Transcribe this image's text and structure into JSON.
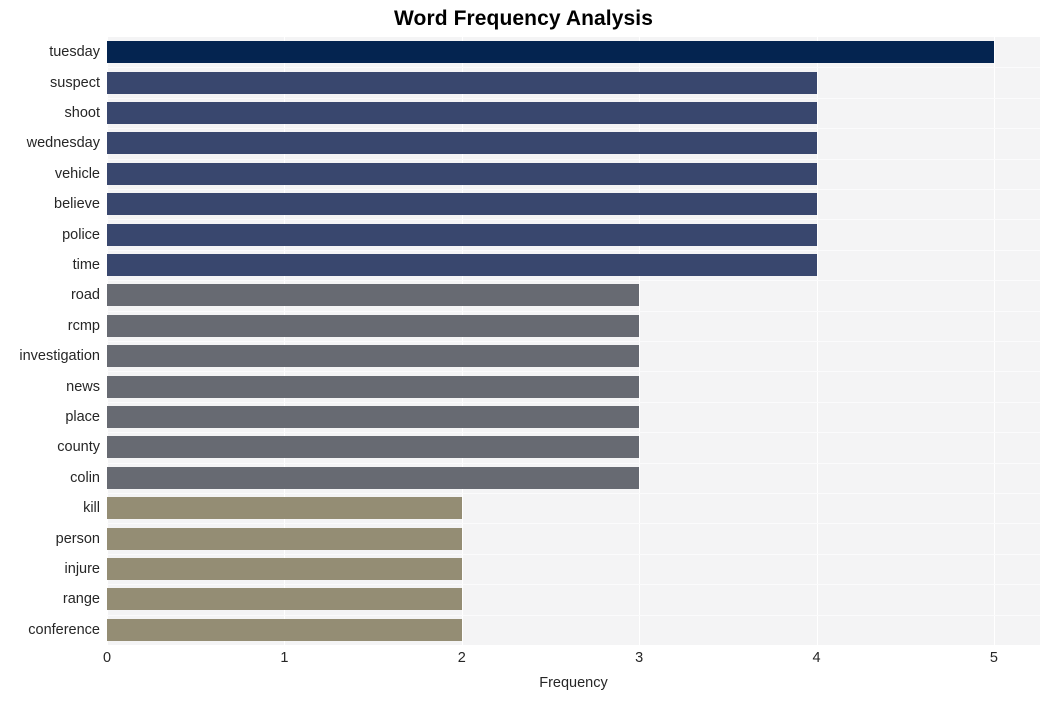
{
  "chart_data": {
    "type": "bar",
    "orientation": "horizontal",
    "title": "Word Frequency Analysis",
    "xlabel": "Frequency",
    "ylabel": "",
    "categories": [
      "tuesday",
      "suspect",
      "shoot",
      "wednesday",
      "vehicle",
      "believe",
      "police",
      "time",
      "road",
      "rcmp",
      "investigation",
      "news",
      "place",
      "county",
      "colin",
      "kill",
      "person",
      "injure",
      "range",
      "conference"
    ],
    "values": [
      5,
      4,
      4,
      4,
      4,
      4,
      4,
      4,
      3,
      3,
      3,
      3,
      3,
      3,
      3,
      2,
      2,
      2,
      2,
      2
    ],
    "bar_colors": [
      "#042450",
      "#39476e",
      "#39476e",
      "#39476e",
      "#39476e",
      "#39476e",
      "#39476e",
      "#39476e",
      "#676a72",
      "#676a72",
      "#676a72",
      "#676a72",
      "#676a72",
      "#676a72",
      "#676a72",
      "#948d74",
      "#948d74",
      "#948d74",
      "#948d74",
      "#948d74"
    ],
    "xlim": [
      0,
      5.26
    ],
    "xticks": [
      0,
      1,
      2,
      3,
      4,
      5
    ],
    "xtick_labels": [
      "0",
      "1",
      "2",
      "3",
      "4",
      "5"
    ],
    "grid": true,
    "grid_color": "#ffffff",
    "plot_background": "#f4f4f5",
    "figure_background": "#ffffff",
    "legend": null
  }
}
